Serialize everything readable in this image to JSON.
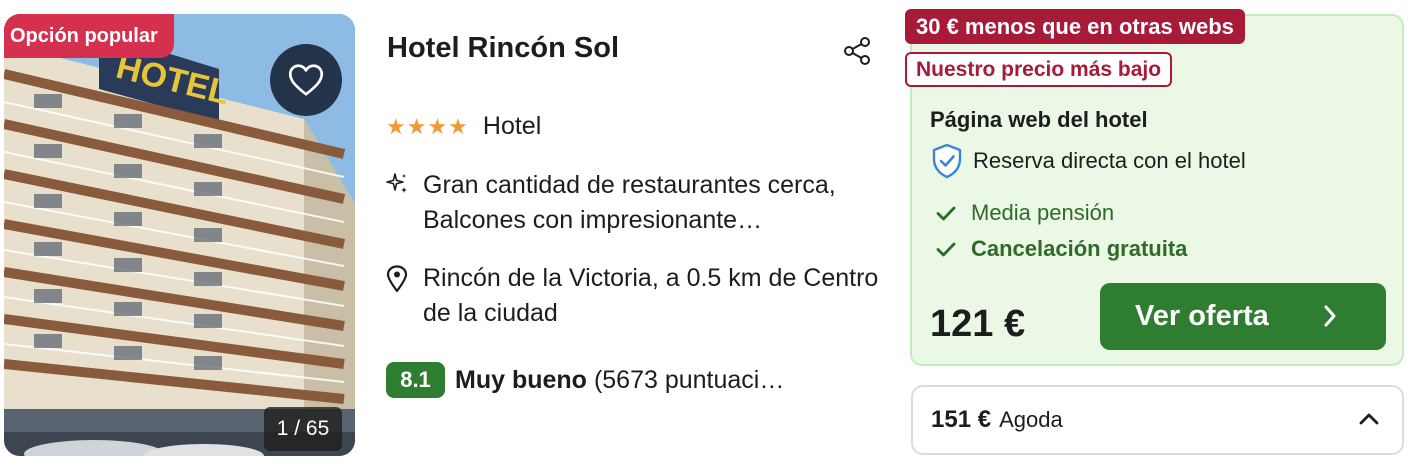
{
  "photo": {
    "badge": "Opción popular",
    "counter": "1 / 65",
    "favorite_icon": "heart-icon"
  },
  "hotel": {
    "name": "Hotel Rincón Sol",
    "stars": 4,
    "stars_text": "★★★★",
    "type": "Hotel",
    "highlights": "Gran cantidad de restaurantes cerca, Balcones con impresionante…",
    "location": "Rincón de la Victoria, a 0.5 km de Centro de la ciudad",
    "rating": {
      "score": "8.1",
      "label": "Muy bueno",
      "count": "(5673 puntuaci…"
    }
  },
  "offer": {
    "save_tag": "30 € menos que en otras webs",
    "lowest_tag": "Nuestro precio más bajo",
    "provider": "Página web del hotel",
    "direct": "Reserva directa con el hotel",
    "perks": [
      "Media pensión",
      "Cancelación gratuita"
    ],
    "price": "121 €",
    "cta": "Ver oferta"
  },
  "alternative": {
    "price": "151 €",
    "provider": "Agoda"
  },
  "colors": {
    "popular_badge": "#d5304e",
    "deal_tag": "#a71b38",
    "cta_green": "#2f7d31",
    "offer_bg": "#ebf8e6",
    "stars": "#f19a34"
  }
}
